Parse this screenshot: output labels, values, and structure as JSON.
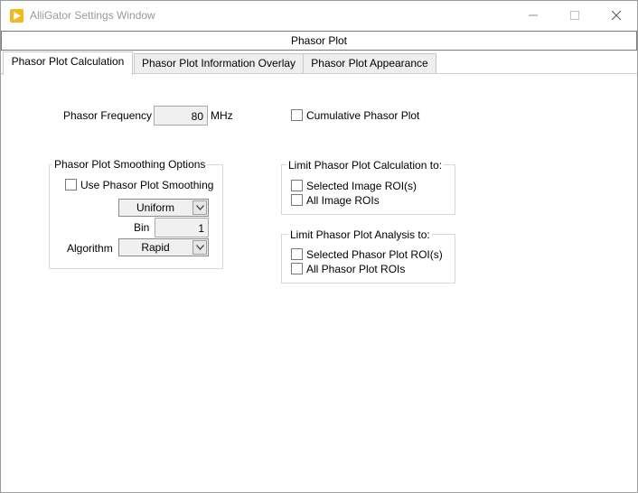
{
  "window": {
    "title": "AlliGator Settings Window",
    "minimize_glyph": "—",
    "maximize_glyph": "☐",
    "close_glyph": "✕"
  },
  "header": {
    "title": "Phasor Plot"
  },
  "tabs": [
    {
      "label": "Phasor Plot Calculation",
      "active": true
    },
    {
      "label": "Phasor Plot Information Overlay",
      "active": false
    },
    {
      "label": "Phasor Plot Appearance",
      "active": false
    }
  ],
  "frequency": {
    "label": "Phasor Frequency",
    "value": "80",
    "unit": "MHz"
  },
  "cumulative": {
    "label": "Cumulative Phasor Plot",
    "checked": false
  },
  "smoothing": {
    "group_title": "Phasor Plot Smoothing Options",
    "use_label": "Use Phasor Plot Smoothing",
    "use_checked": false,
    "kernel_value": "Uniform",
    "bin_label": "Bin",
    "bin_value": "1",
    "algorithm_label": "Algorithm",
    "algorithm_value": "Rapid"
  },
  "limit_calc": {
    "group_title": "Limit Phasor Plot Calculation  to:",
    "options": [
      "Selected Image ROI(s)",
      "All Image ROIs"
    ]
  },
  "limit_analysis": {
    "group_title": "Limit Phasor Plot Analysis  to:",
    "options": [
      "Selected Phasor Plot ROI(s)",
      "All Phasor Plot ROIs"
    ]
  },
  "icons": {
    "app": "alligator-app-icon",
    "dropdown": "chevron-down-icon"
  }
}
